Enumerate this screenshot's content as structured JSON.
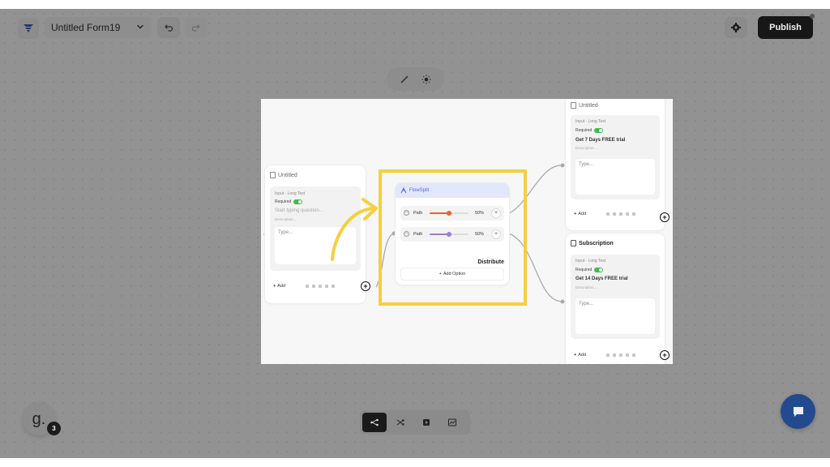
{
  "header": {
    "form_title": "Untitled Form19",
    "publish_label": "Publish"
  },
  "cards": {
    "left": {
      "title": "Untitled",
      "input_type": "Input - Long Text",
      "required_label": "Required",
      "question_placeholder": "Start typing question...",
      "description_placeholder": "Description...",
      "type_placeholder": "Type...",
      "add_label": "Add"
    },
    "flowsplit": {
      "title": "FlowSplit",
      "paths": [
        {
          "label": "Path",
          "percent": "50%",
          "value": 0.5,
          "color": "#e8622c"
        },
        {
          "label": "Path",
          "percent": "50%",
          "value": 0.5,
          "color": "#9b7fd1"
        }
      ],
      "distribute_label": "Distribute",
      "add_option_label": "Add Option"
    },
    "top_right": {
      "title": "Untitled",
      "input_type": "Input - Long Text",
      "required_label": "Required",
      "question": "Get 7 Days FREE trial",
      "description_placeholder": "Description...",
      "type_placeholder": "Type...",
      "add_label": "Add"
    },
    "bottom_right": {
      "title": "Subscription",
      "input_type": "Input - Long Text",
      "required_label": "Required",
      "question": "Get 14 Days FREE trial",
      "description_placeholder": "Description...",
      "type_placeholder": "Type...",
      "add_label": "Add"
    }
  },
  "avatar": {
    "letter": "g.",
    "badge_count": "3"
  },
  "colors": {
    "highlight": "#f5cf3e",
    "publish_bg": "#171717",
    "chat_bg": "#234a8e",
    "toggle_on": "#3fb950",
    "flowsplit_header": "#e3e7fb"
  },
  "icons": [
    "form-logo-icon",
    "chevron-down-icon",
    "undo-icon",
    "redo-icon",
    "gear-icon",
    "magic-wand-icon",
    "sun-icon",
    "flow-icon",
    "shuffle-icon",
    "play-icon",
    "analytics-icon",
    "chat-icon",
    "arrow-annotation-icon"
  ]
}
